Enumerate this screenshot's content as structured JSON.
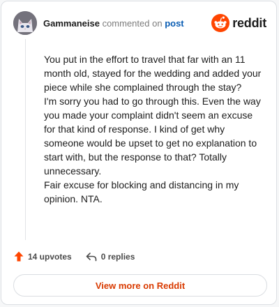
{
  "comment": {
    "author": "Gammaneise",
    "action_text": "commented on",
    "target_text": "post",
    "paragraphs": [
      "You put in the effort to travel that far with an 11 month old, stayed for the wedding and added your piece while she complained through the stay?",
      "I'm sorry you had to go through this. Even the way you made your complaint didn't seem an excuse for that kind of response. I kind of get why someone would be upset to get no explanation to start with, but the response to that? Totally unnecessary.",
      "Fair excuse for blocking and distancing in my opinion. NTA."
    ],
    "upvotes_label": "14 upvotes",
    "replies_label": "0 replies"
  },
  "brand": {
    "name": "reddit",
    "icon": "reddit-snoo-icon",
    "color": "#ff4500"
  },
  "footer": {
    "view_more_label": "View more on Reddit",
    "accent_color": "#d93a00"
  },
  "icons": {
    "avatar": "cat-avatar",
    "upvote": "upvote-arrow-icon",
    "reply": "reply-arrow-icon"
  }
}
